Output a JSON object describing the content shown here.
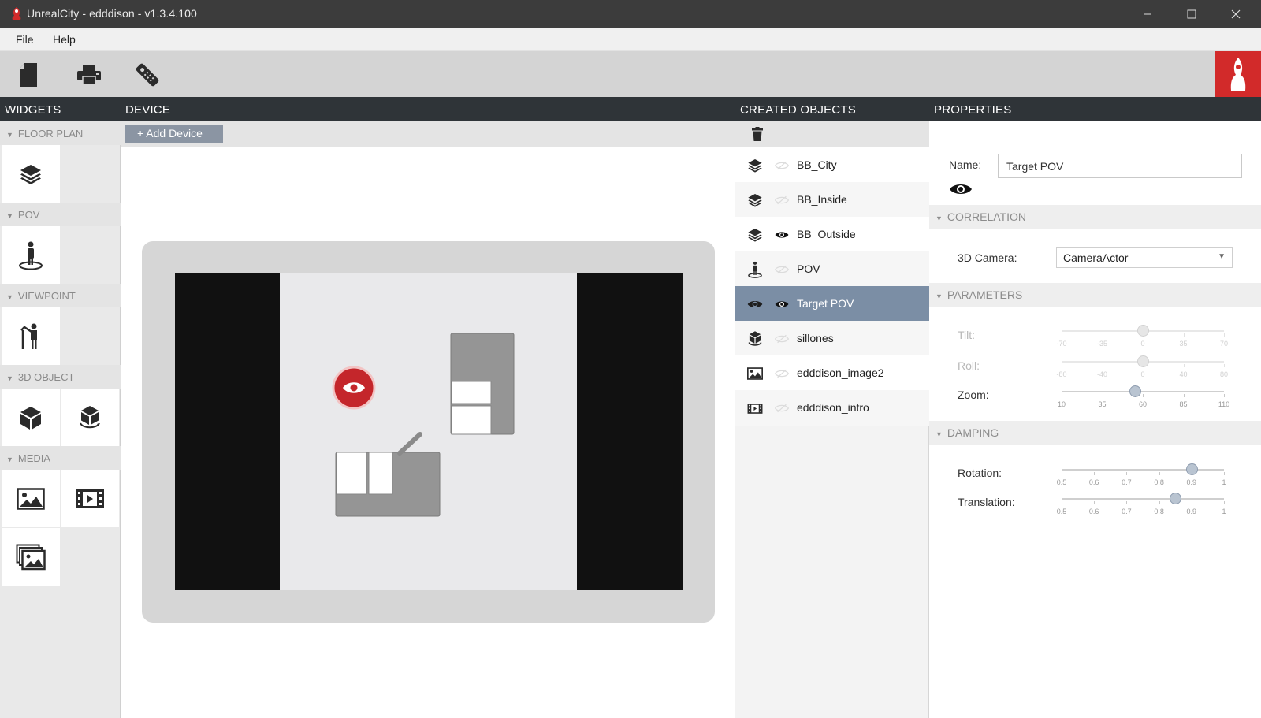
{
  "window": {
    "title": "UnrealCity  -  edddison  -  v1.3.4.100"
  },
  "menu": {
    "file": "File",
    "help": "Help"
  },
  "toolbar": {
    "icons": [
      "new-document-icon",
      "print-icon",
      "remote-control-icon"
    ],
    "brand_color": "#d22a2a"
  },
  "panels": {
    "widgets": "WIDGETS",
    "device": "DEVICE",
    "created_objects": "CREATED OBJECTS",
    "properties": "PROPERTIES"
  },
  "widgets": {
    "sections": [
      "FLOOR PLAN",
      "POV",
      "VIEWPOINT",
      "3D OBJECT",
      "MEDIA"
    ]
  },
  "device": {
    "add_label": "+ Add Device"
  },
  "objects": [
    {
      "label": "BB_City",
      "icon": "layers-icon",
      "visible": false
    },
    {
      "label": "BB_Inside",
      "icon": "layers-icon",
      "visible": false
    },
    {
      "label": "BB_Outside",
      "icon": "layers-icon",
      "visible": true
    },
    {
      "label": "POV",
      "icon": "pov-icon",
      "visible": false
    },
    {
      "label": "Target POV",
      "icon": "eye-icon",
      "visible": true,
      "selected": true
    },
    {
      "label": "sillones",
      "icon": "cube-rotate-icon",
      "visible": false
    },
    {
      "label": "edddison_image2",
      "icon": "image-icon",
      "visible": false
    },
    {
      "label": "edddison_intro",
      "icon": "video-icon",
      "visible": false
    }
  ],
  "properties": {
    "name_label": "Name:",
    "name_value": "Target POV",
    "correlation": "CORRELATION",
    "camera_label": "3D Camera:",
    "camera_value": "CameraActor",
    "parameters": "PARAMETERS",
    "tilt_label": "Tilt:",
    "roll_label": "Roll:",
    "zoom_label": "Zoom:",
    "tilt_ticks": [
      "-70",
      "-35",
      "0",
      "35",
      "70"
    ],
    "roll_ticks": [
      "-80",
      "-40",
      "0",
      "40",
      "80"
    ],
    "zoom_ticks": [
      "10",
      "35",
      "60",
      "85",
      "110"
    ],
    "tilt_value": 0,
    "roll_value": 0,
    "zoom_value": 55,
    "damping": "DAMPING",
    "rotation_label": "Rotation:",
    "translation_label": "Translation:",
    "damping_ticks": [
      "0.5",
      "0.6",
      "0.7",
      "0.8",
      "0.9",
      "1"
    ],
    "rotation_value": 0.9,
    "translation_value": 0.85
  },
  "colors": {
    "accent_red": "#d22a2a",
    "selection": "#7b8ea5",
    "header": "#2f3438"
  }
}
